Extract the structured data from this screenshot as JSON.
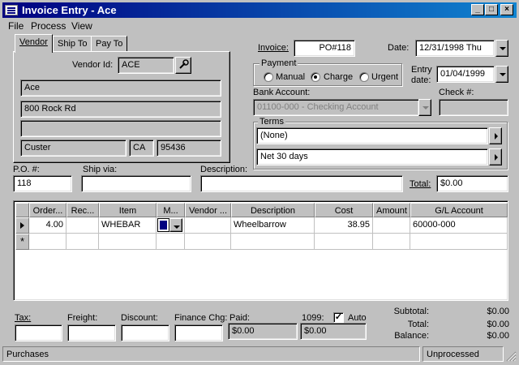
{
  "window": {
    "title": "Invoice Entry - Ace"
  },
  "menu": [
    "File",
    "Process",
    "View"
  ],
  "tabs": [
    "Vendor",
    "Ship To",
    "Pay To"
  ],
  "vendor": {
    "id_label": "Vendor Id:",
    "id_value": "ACE",
    "name": "Ace",
    "address1": "800 Rock Rd",
    "address2": "",
    "city": "Custer",
    "state": "CA",
    "zip": "95436"
  },
  "invoice": {
    "label": "Invoice:",
    "value": "PO#118"
  },
  "date": {
    "label": "Date:",
    "value": "12/31/1998 Thu"
  },
  "payment": {
    "label": "Payment",
    "options": [
      "Manual",
      "Charge",
      "Urgent"
    ],
    "selected": "Charge"
  },
  "entry_date": {
    "label_line1": "Entry",
    "label_line2": "date:",
    "value": "01/04/1999"
  },
  "bank_account": {
    "label": "Bank Account:",
    "value": "01100-000 - Checking Account"
  },
  "check_no": {
    "label": "Check #:",
    "value": ""
  },
  "terms": {
    "label": "Terms",
    "value1": "(None)",
    "value2": "Net  30 days"
  },
  "po": {
    "label": "P.O. #:",
    "value": "118"
  },
  "ship_via": {
    "label": "Ship via:",
    "value": ""
  },
  "description": {
    "label": "Description:",
    "value": ""
  },
  "total_field": {
    "label": "Total:",
    "value": "$0.00"
  },
  "grid": {
    "columns": [
      "Order...",
      "Rec...",
      "Item",
      "M...",
      "Vendor ...",
      "Description",
      "Cost",
      "Amount",
      "G/L Account"
    ],
    "rows": [
      {
        "order": "4.00",
        "rec": "",
        "item": "WHEBAR",
        "m": "",
        "vendor": "",
        "description": "Wheelbarrow",
        "cost": "38.95",
        "amount": "",
        "gl": "60000-000"
      }
    ],
    "new_row_marker": "*"
  },
  "footer": {
    "tax_label": "Tax:",
    "tax": "",
    "freight_label": "Freight:",
    "freight": "",
    "discount_label": "Discount:",
    "discount": "",
    "finance_label": "Finance Chg:",
    "finance": "",
    "paid_label": "Paid:",
    "paid": "$0.00",
    "form1099_label": "1099:",
    "form1099": "$0.00",
    "auto_label": "Auto",
    "auto_checked": true,
    "subtotal_label": "Subtotal:",
    "subtotal": "$0.00",
    "total_label": "Total:",
    "total": "$0.00",
    "balance_label": "Balance:",
    "balance": "$0.00"
  },
  "status": {
    "left": "Purchases",
    "right": "Unprocessed"
  },
  "colors": {
    "titlebar_start": "#000080",
    "titlebar_end": "#1084d0",
    "face": "#c0c0c0"
  }
}
